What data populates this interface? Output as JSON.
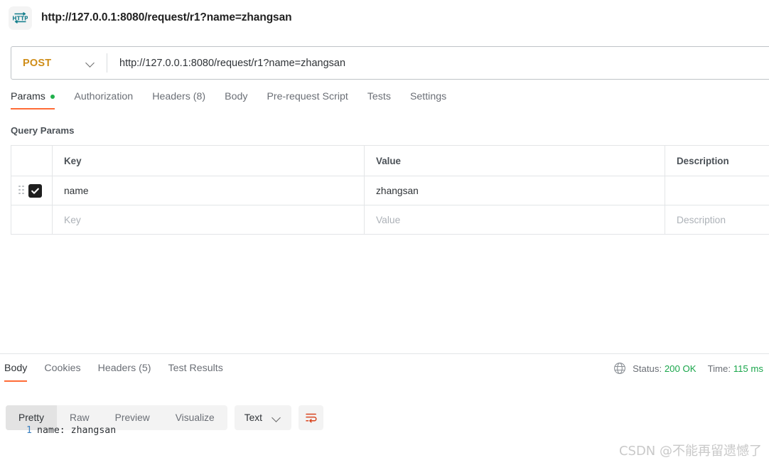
{
  "titlebar": {
    "icon": "http-protocol-icon",
    "title": "http://127.0.0.1:8080/request/r1?name=zhangsan"
  },
  "request": {
    "method": "POST",
    "method_color": "#cf8d18",
    "url": "http://127.0.0.1:8080/request/r1?name=zhangsan",
    "tabs": [
      {
        "label": "Params",
        "active": true,
        "dot": true
      },
      {
        "label": "Authorization",
        "active": false,
        "dot": false
      },
      {
        "label": "Headers (8)",
        "active": false,
        "dot": false
      },
      {
        "label": "Body",
        "active": false,
        "dot": false
      },
      {
        "label": "Pre-request Script",
        "active": false,
        "dot": false
      },
      {
        "label": "Tests",
        "active": false,
        "dot": false
      },
      {
        "label": "Settings",
        "active": false,
        "dot": false
      }
    ],
    "accent_color": "#ff6c37",
    "dot_color": "#20b04b"
  },
  "query_params": {
    "section_title": "Query Params",
    "columns": [
      "Key",
      "Value",
      "Description"
    ],
    "rows": [
      {
        "checked": true,
        "key": "name",
        "value": "zhangsan",
        "description": ""
      }
    ],
    "placeholder_row": {
      "key": "Key",
      "value": "Value",
      "description": "Description"
    }
  },
  "response": {
    "tabs": [
      {
        "label": "Body",
        "active": true
      },
      {
        "label": "Cookies",
        "active": false
      },
      {
        "label": "Headers (5)",
        "active": false
      },
      {
        "label": "Test Results",
        "active": false
      }
    ],
    "status_label": "Status:",
    "status_value": "200 OK",
    "time_label": "Time:",
    "time_value": "115 ms",
    "status_color": "#1aa64b",
    "globe_icon": "globe-icon",
    "view_modes": [
      {
        "label": "Pretty",
        "active": true
      },
      {
        "label": "Raw",
        "active": false
      },
      {
        "label": "Preview",
        "active": false
      },
      {
        "label": "Visualize",
        "active": false
      }
    ],
    "format_select": "Text",
    "wrap_icon": "word-wrap-icon",
    "body_lines": [
      {
        "number": "1",
        "text": "name: zhangsan"
      }
    ]
  },
  "watermark": "CSDN @不能再留遗憾了"
}
